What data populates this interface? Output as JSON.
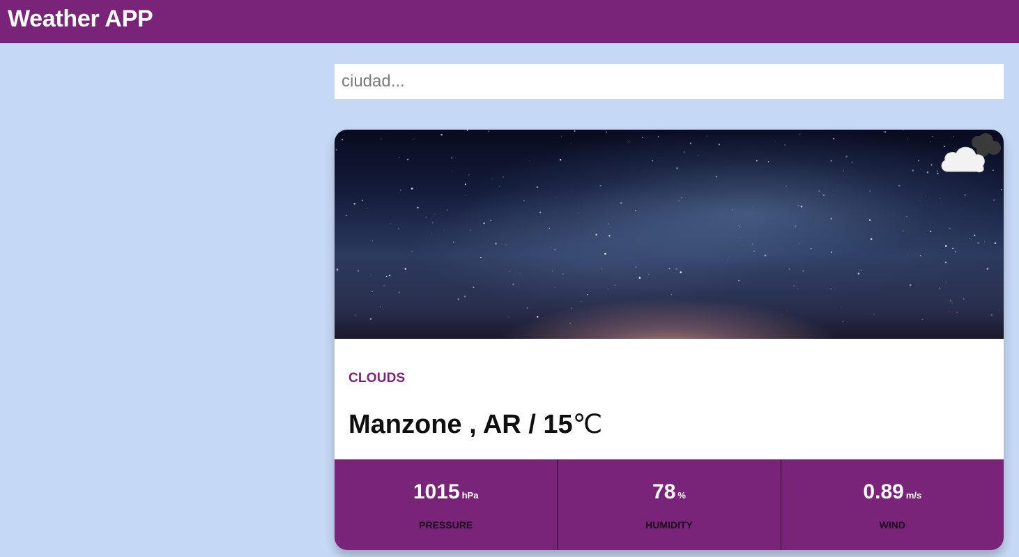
{
  "app": {
    "title": "Weather APP"
  },
  "search": {
    "placeholder": "ciudad...",
    "value": ""
  },
  "weather": {
    "description": "CLOUDS",
    "location": "Manzone , AR / 15",
    "temp_unit": "℃",
    "icon": "clouds-icon",
    "stats": [
      {
        "value": "1015",
        "unit": "hPa",
        "label": "PRESSURE"
      },
      {
        "value": "78",
        "unit": "%",
        "label": "HUMIDITY"
      },
      {
        "value": "0.89",
        "unit": "m/s",
        "label": "WIND"
      }
    ]
  },
  "colors": {
    "accent": "#7a2479",
    "background": "#c5d8f5",
    "card": "#ffffff"
  }
}
